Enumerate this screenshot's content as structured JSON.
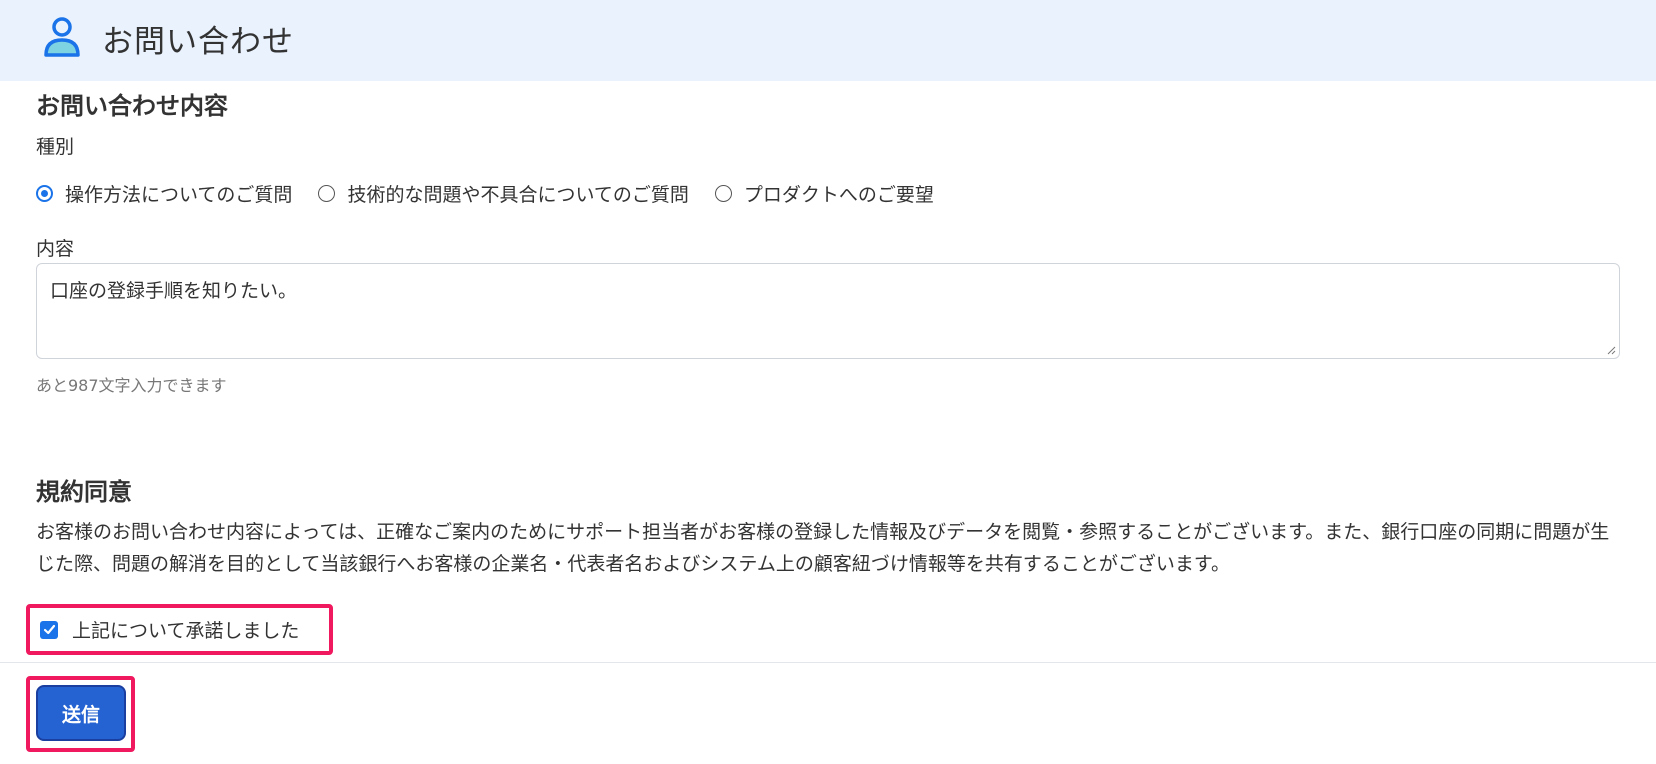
{
  "header": {
    "title": "お問い合わせ",
    "icon": "user-icon"
  },
  "inquiry": {
    "section_title": "お問い合わせ内容",
    "type_label": "種別",
    "options": [
      {
        "label": "操作方法についてのご質問",
        "checked": true
      },
      {
        "label": "技術的な問題や不具合についてのご質問",
        "checked": false
      },
      {
        "label": "プロダクトへのご要望",
        "checked": false
      }
    ],
    "content_label": "内容",
    "content_value": "口座の登録手順を知りたい。",
    "char_hint": "あと987文字入力できます"
  },
  "terms": {
    "section_title": "規約同意",
    "body": "お客様のお問い合わせ内容によっては、正確なご案内のためにサポート担当者がお客様の登録した情報及びデータを閲覧・参照することがございます。また、銀行口座の同期に問題が生じた際、問題の解消を目的として当該銀行へお客様の企業名・代表者名およびシステム上の顧客紐づけ情報等を共有することがございます。",
    "agree_label": "上記について承諾しました",
    "agreed": true
  },
  "actions": {
    "submit_label": "送信"
  },
  "colors": {
    "header_bg": "#eaf2fd",
    "accent": "#1a73e8",
    "submit": "#2563d2",
    "highlight": "#f0185e"
  }
}
